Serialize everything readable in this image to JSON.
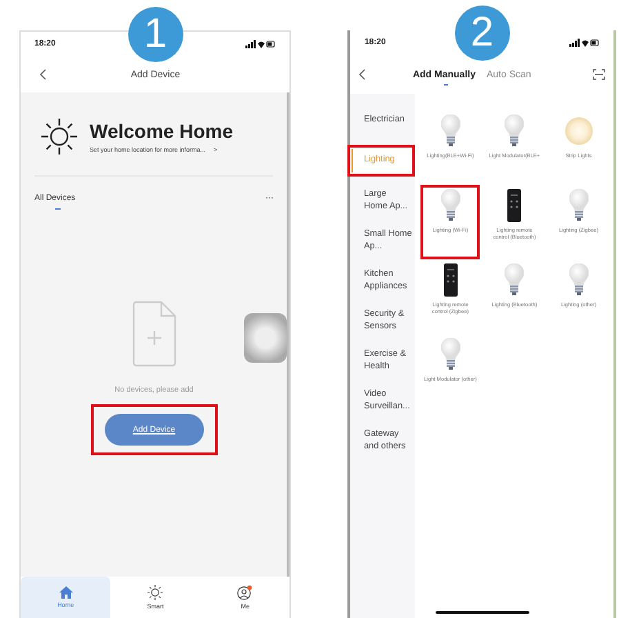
{
  "steps": [
    {
      "number": "1",
      "status_time": "18:20",
      "nav_title": "Add Device",
      "home": {
        "title": "Welcome Home",
        "subtitle": "Set your home location for more informa...",
        "chevron": ">"
      },
      "section": {
        "label": "All Devices",
        "more": "···"
      },
      "empty_text": "No devices, please add",
      "add_button": {
        "label": "Add Device",
        "highlighted": true
      },
      "tab_bar": [
        {
          "label": "Home",
          "kind": "home",
          "selected": true
        },
        {
          "label": "Smart",
          "kind": "smart",
          "selected": false
        },
        {
          "label": "Me",
          "kind": "me",
          "selected": false
        }
      ]
    },
    {
      "number": "2",
      "status_time": "18:20",
      "tabs": [
        {
          "label": "Add Manually",
          "selected": true
        },
        {
          "label": "Auto Scan",
          "selected": false
        }
      ],
      "categories": [
        {
          "label": "Electrician",
          "selected": false,
          "highlighted": false
        },
        {
          "label": "Lighting",
          "selected": true,
          "highlighted": true
        },
        {
          "label": "Large Home Ap...",
          "selected": false,
          "highlighted": false
        },
        {
          "label": "Small Home Ap...",
          "selected": false,
          "highlighted": false
        },
        {
          "label": "Kitchen Appliances",
          "selected": false,
          "highlighted": false
        },
        {
          "label": "Security & Sensors",
          "selected": false,
          "highlighted": false
        },
        {
          "label": "Exercise & Health",
          "selected": false,
          "highlighted": false
        },
        {
          "label": "Video Surveillan...",
          "selected": false,
          "highlighted": false
        },
        {
          "label": "Gateway and others",
          "selected": false,
          "highlighted": false
        }
      ],
      "devices": [
        {
          "label": "Lighting(BLE+Wi-Fi)",
          "kind": "bulb",
          "highlighted": false
        },
        {
          "label": "Light Modulator(BLE+",
          "kind": "bulb",
          "highlighted": false
        },
        {
          "label": "Strip Lights",
          "kind": "strip",
          "highlighted": false
        },
        {
          "label": "Lighting (Wi-Fi)",
          "kind": "bulb",
          "highlighted": true
        },
        {
          "label": "Lighting remote control (Bluetooth)",
          "kind": "remote",
          "highlighted": false
        },
        {
          "label": "Lighting (Zigbee)",
          "kind": "bulb",
          "highlighted": false
        },
        {
          "label": "Lighting remote control (Zigbee)",
          "kind": "remote",
          "highlighted": false
        },
        {
          "label": "Lighting (Bluetooth)",
          "kind": "bulb",
          "highlighted": false
        },
        {
          "label": "Lighting (other)",
          "kind": "bulb",
          "highlighted": false
        },
        {
          "label": "Light Modulator (other)",
          "kind": "bulb",
          "highlighted": false
        }
      ]
    }
  ]
}
